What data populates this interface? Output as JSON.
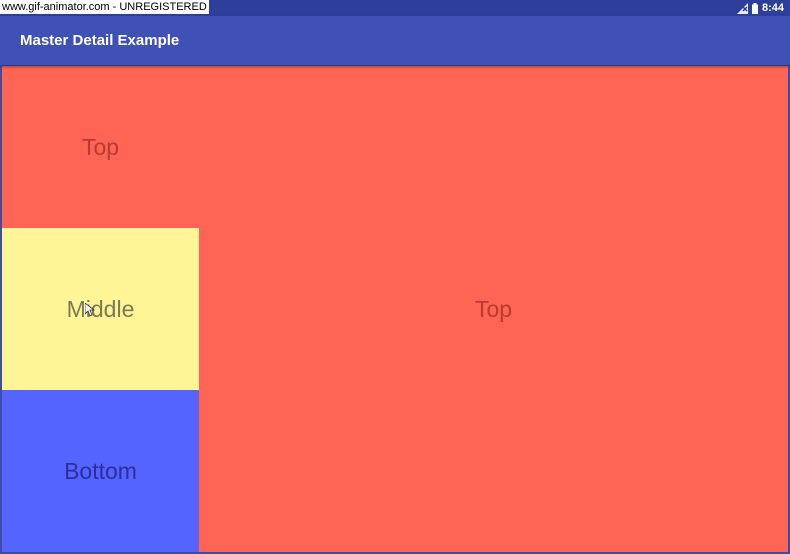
{
  "watermark": "www.gif-animator.com - UNREGISTERED",
  "status_bar": {
    "time": "8:44",
    "icons": [
      "signal-icon",
      "battery-icon"
    ]
  },
  "app_bar": {
    "title": "Master Detail Example"
  },
  "master_list": {
    "items": [
      {
        "label": "Top",
        "color": "#ff6455"
      },
      {
        "label": "Middle",
        "color": "#fff596"
      },
      {
        "label": "Bottom",
        "color": "#5563ff"
      }
    ]
  },
  "detail": {
    "label": "Top",
    "color": "#ff6455"
  },
  "colors": {
    "status_bar": "#2d3f9a",
    "app_bar": "#3f51b5"
  }
}
